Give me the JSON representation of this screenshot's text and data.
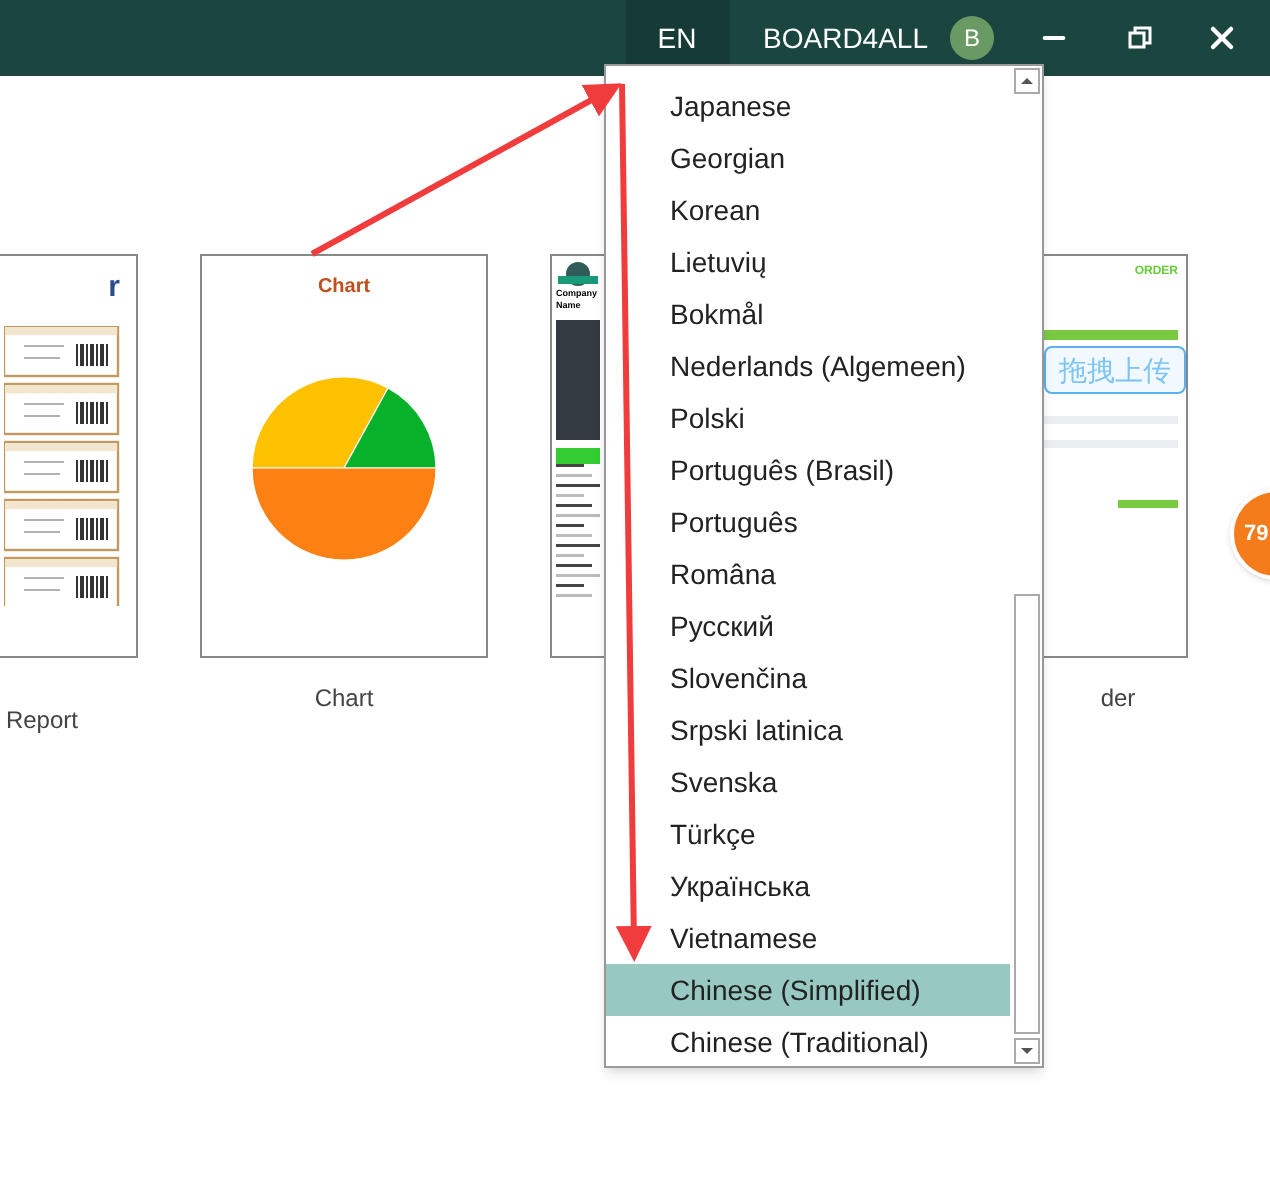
{
  "header": {
    "language_button": "EN",
    "user_name": "BOARD4ALL",
    "avatar_initial": "B"
  },
  "templates": [
    {
      "kind": "report",
      "heading": "r",
      "label": "Report"
    },
    {
      "kind": "chart",
      "heading": "Chart",
      "label": "Chart"
    },
    {
      "kind": "invoice",
      "heading": "Company Name"
    },
    {
      "kind": "order",
      "heading": "ORDER",
      "label": "der"
    }
  ],
  "language_menu": [
    {
      "label": "Japanese",
      "selected": false
    },
    {
      "label": "Georgian",
      "selected": false
    },
    {
      "label": "Korean",
      "selected": false
    },
    {
      "label": "Lietuvių",
      "selected": false
    },
    {
      "label": "Bokmål",
      "selected": false
    },
    {
      "label": "Nederlands (Algemeen)",
      "selected": false
    },
    {
      "label": "Polski",
      "selected": false
    },
    {
      "label": "Português (Brasil)",
      "selected": false
    },
    {
      "label": "Português",
      "selected": false
    },
    {
      "label": "Româna",
      "selected": false
    },
    {
      "label": "Русский",
      "selected": false
    },
    {
      "label": "Slovenčina",
      "selected": false
    },
    {
      "label": "Srpski latinica",
      "selected": false
    },
    {
      "label": "Svenska",
      "selected": false
    },
    {
      "label": "Türkçe",
      "selected": false
    },
    {
      "label": "Українська",
      "selected": false
    },
    {
      "label": "Vietnamese",
      "selected": false
    },
    {
      "label": "Chinese (Simplified)",
      "selected": true
    },
    {
      "label": "Chinese (Traditional)",
      "selected": false
    }
  ],
  "upload_button": "拖拽上传",
  "badge": "79"
}
